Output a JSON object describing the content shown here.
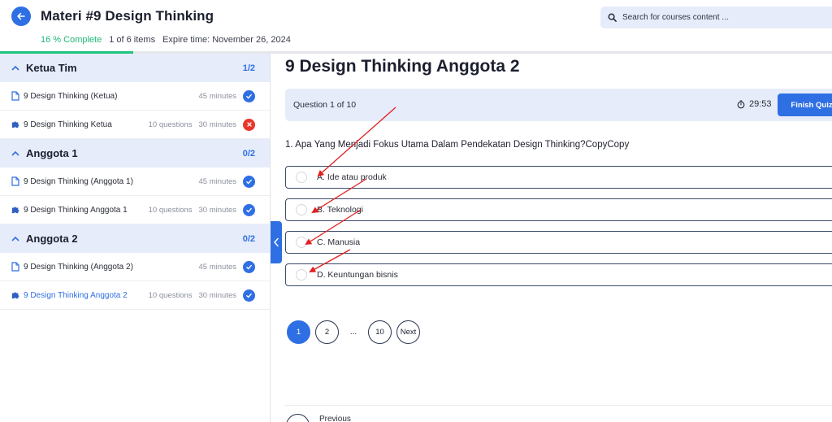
{
  "header": {
    "title": "Materi #9 Design Thinking",
    "complete": "16 % Complete",
    "items": "1 of 6 items",
    "expire": "Expire time: November 26, 2024",
    "progress_fraction": 0.16,
    "search_placeholder": "Search for courses content ..."
  },
  "sidebar": {
    "sections": [
      {
        "title": "Ketua Tim",
        "count": "1/2",
        "lessons": [
          {
            "title": "9 Design Thinking (Ketua)",
            "questions": "",
            "duration": "45 minutes",
            "status": "done",
            "kind": "doc"
          },
          {
            "title": "9 Design Thinking Ketua",
            "questions": "10 questions",
            "duration": "30 minutes",
            "status": "fail",
            "kind": "quiz"
          }
        ]
      },
      {
        "title": "Anggota 1",
        "count": "0/2",
        "lessons": [
          {
            "title": "9 Design Thinking (Anggota 1)",
            "questions": "",
            "duration": "45 minutes",
            "status": "done",
            "kind": "doc"
          },
          {
            "title": "9 Design Thinking Anggota 1",
            "questions": "10 questions",
            "duration": "30 minutes",
            "status": "done",
            "kind": "quiz"
          }
        ]
      },
      {
        "title": "Anggota 2",
        "count": "0/2",
        "lessons": [
          {
            "title": "9 Design Thinking (Anggota 2)",
            "questions": "",
            "duration": "45 minutes",
            "status": "done",
            "kind": "doc"
          },
          {
            "title": "9 Design Thinking Anggota 2",
            "questions": "10 questions",
            "duration": "30 minutes",
            "status": "done",
            "kind": "quiz",
            "active": true
          }
        ]
      }
    ]
  },
  "quiz": {
    "title": "9 Design Thinking Anggota 2",
    "question_counter": "Question 1 of 10",
    "timer": "29:53",
    "finish_label": "Finish Quiz",
    "question": "1. Apa Yang Menjadi Fokus Utama Dalam Pendekatan Design Thinking?CopyCopy",
    "options": [
      "A. Ide atau produk",
      "B. Teknologi",
      "C. Manusia",
      "D. Keuntungan bisnis"
    ],
    "pagination": {
      "current": "1",
      "second": "2",
      "dots": "...",
      "last": "10",
      "next": "Next"
    },
    "previous_label": "Previous"
  },
  "colors": {
    "accent": "#2f6fe4",
    "success": "#1fc47c",
    "danger": "#e8372c",
    "annotation": "#e02020"
  }
}
